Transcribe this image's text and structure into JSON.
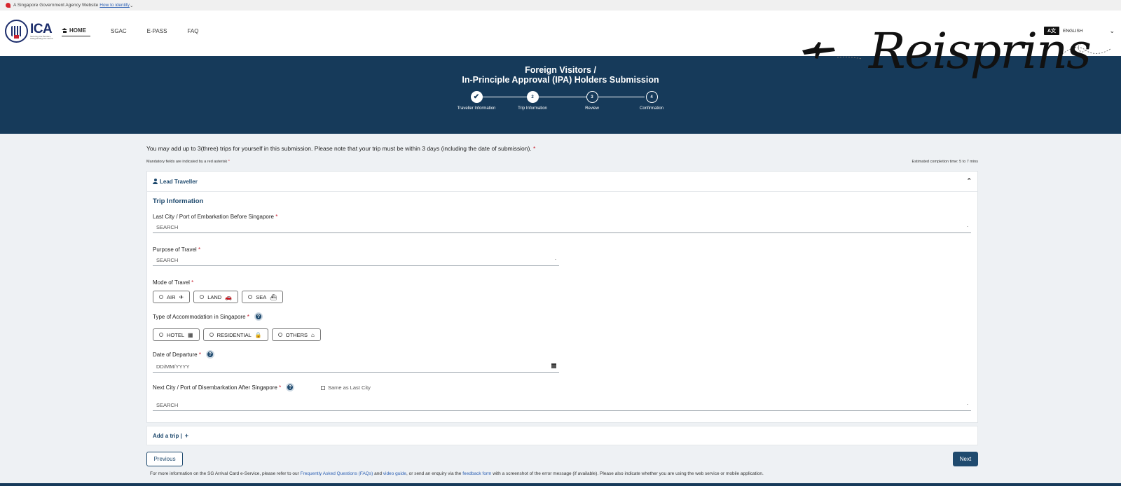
{
  "gov_banner": {
    "text": "A Singapore Government Agency Website",
    "link": "How to identify",
    "chevron": "⌄"
  },
  "logo": {
    "name": "ICA",
    "tagline": "Securing Our Borders, Safeguarding Our Home"
  },
  "nav": {
    "items": [
      {
        "label": "HOME",
        "active": true
      },
      {
        "label": "SGAC"
      },
      {
        "label": "E-PASS"
      },
      {
        "label": "FAQ"
      }
    ]
  },
  "language": {
    "icon_text": "A文",
    "label": "ENGLISH",
    "chevron": "⌄"
  },
  "watermark": {
    "text": "Reisprins"
  },
  "hero": {
    "title_line1": "Foreign Visitors /",
    "title_line2": "In-Principle Approval (IPA) Holders Submission"
  },
  "stepper": {
    "steps": [
      {
        "marker": "✔",
        "label": "Traveller Information",
        "state": "done"
      },
      {
        "marker": "2",
        "label": "Trip Information",
        "state": "current"
      },
      {
        "marker": "3",
        "label": "Review",
        "state": "pending"
      },
      {
        "marker": "4",
        "label": "Confirmation",
        "state": "pending"
      }
    ]
  },
  "notice": {
    "text": "You may add up to 3(three) trips for yourself in this submission. Please note that your trip must be within 3 days (including the date of submission).",
    "asterisk": "*"
  },
  "mandatory_note": "Mandatory fields are indicated by a red asterisk",
  "estimate": "Estimated completion time: 5 to 7 mins",
  "card": {
    "header": "Lead Traveller",
    "collapse_glyph": "⌃",
    "section_title": "Trip Information",
    "fields": {
      "last_city": {
        "label": "Last City / Port of Embarkation Before Singapore",
        "placeholder": "SEARCH"
      },
      "purpose": {
        "label": "Purpose of Travel",
        "placeholder": "SEARCH"
      },
      "mode": {
        "label": "Mode of Travel",
        "options": [
          {
            "label": "AIR",
            "icon": "✈"
          },
          {
            "label": "LAND",
            "icon": "🚗"
          },
          {
            "label": "SEA",
            "icon": "⛴"
          }
        ]
      },
      "accommodation": {
        "label": "Type of Accommodation in Singapore",
        "options": [
          {
            "label": "HOTEL",
            "icon": "▦"
          },
          {
            "label": "RESIDENTIAL",
            "icon": "🔒"
          },
          {
            "label": "OTHERS",
            "icon": "⌂"
          }
        ]
      },
      "departure": {
        "label": "Date of Departure",
        "placeholder": "DD/MM/YYYY"
      },
      "next_city": {
        "label": "Next City / Port of Disembarkation After Singapore",
        "placeholder": "SEARCH",
        "same_as_label": "Same as Last City"
      }
    },
    "info_glyph": "?",
    "dropdown_caret": "-",
    "asterisk": "*"
  },
  "add_trip": {
    "label": "Add a trip |",
    "plus": "+"
  },
  "buttons": {
    "previous": "Previous",
    "next": "Next"
  },
  "footer": {
    "part1": "For more information on the SG Arrival Card e-Service, please refer to our ",
    "link_faq": "Frequently Asked Questions (FAQs)",
    "part2": " and ",
    "link_video": "video guide",
    "part3": ", or send an enquiry via the ",
    "link_feedback": "feedback form",
    "part4": " with a screenshot of the error message (if available). Please also indicate whether you are using the web service or mobile application."
  }
}
